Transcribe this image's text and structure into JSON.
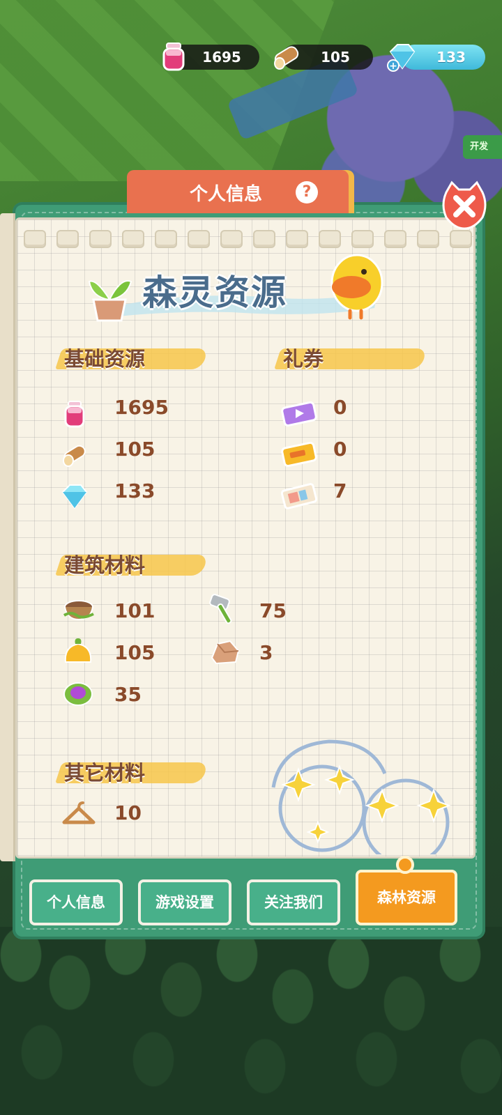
{
  "top_bar": {
    "potion": {
      "icon": "potion-jar-icon",
      "value": "1695"
    },
    "wood": {
      "icon": "wood-log-icon",
      "value": "105"
    },
    "gem": {
      "icon": "gem-plus-icon",
      "value": "133"
    }
  },
  "side_tag": "开发",
  "dialog": {
    "title": "个人信息",
    "help_glyph": "?",
    "banner_title": "森灵资源"
  },
  "sections": {
    "basic": {
      "label": "基础资源",
      "items": [
        {
          "icon": "potion-jar-icon",
          "value": "1695"
        },
        {
          "icon": "wood-log-icon",
          "value": "105"
        },
        {
          "icon": "gem-icon",
          "value": "133"
        }
      ]
    },
    "coupons": {
      "label": "礼券",
      "items": [
        {
          "icon": "video-ticket-icon",
          "value": "0"
        },
        {
          "icon": "gold-ticket-icon",
          "value": "0"
        },
        {
          "icon": "paper-ticket-icon",
          "value": "7"
        }
      ]
    },
    "building": {
      "label": "建筑材料",
      "items": [
        {
          "icon": "bowl-vine-icon",
          "value": "101"
        },
        {
          "icon": "hammer-icon",
          "value": "75"
        },
        {
          "icon": "orange-fruit-icon",
          "value": "105"
        },
        {
          "icon": "stone-icon",
          "value": "3"
        },
        {
          "icon": "purple-cabbage-icon",
          "value": "35"
        }
      ]
    },
    "other": {
      "label": "其它材料",
      "items": [
        {
          "icon": "hanger-icon",
          "value": "10"
        }
      ]
    }
  },
  "tabs": [
    {
      "label": "个人信息",
      "active": false
    },
    {
      "label": "游戏设置",
      "active": false
    },
    {
      "label": "关注我们",
      "active": false
    },
    {
      "label": "森林资源",
      "active": true
    }
  ],
  "colors": {
    "panel": "#3f9c76",
    "header": "#e9714f",
    "active_tab": "#f49a1f",
    "value_text": "#8a4a2a"
  }
}
